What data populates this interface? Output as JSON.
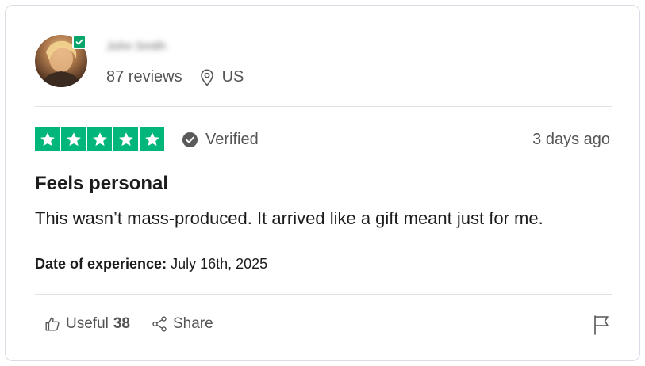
{
  "reviewer": {
    "name": "John Smith",
    "reviews_count": "87 reviews",
    "location": "US"
  },
  "review": {
    "rating": 5,
    "rating_max": 5,
    "verified_label": "Verified",
    "time_ago": "3 days ago",
    "title": "Feels personal",
    "body": "This wasn’t mass-produced. It arrived like a gift meant just for me.",
    "experience_label": "Date of experience:",
    "experience_date": "July 16th, 2025"
  },
  "actions": {
    "useful_label": "Useful",
    "useful_count": "38",
    "share_label": "Share"
  },
  "colors": {
    "star_green": "#00b67a",
    "badge_green": "#04a56a",
    "muted_text": "#555555",
    "divider": "#e1e1e6"
  },
  "icons": [
    "verified-badge-icon",
    "location-pin-icon",
    "star-icon",
    "check-circle-icon",
    "thumbs-up-icon",
    "share-icon",
    "flag-icon"
  ]
}
